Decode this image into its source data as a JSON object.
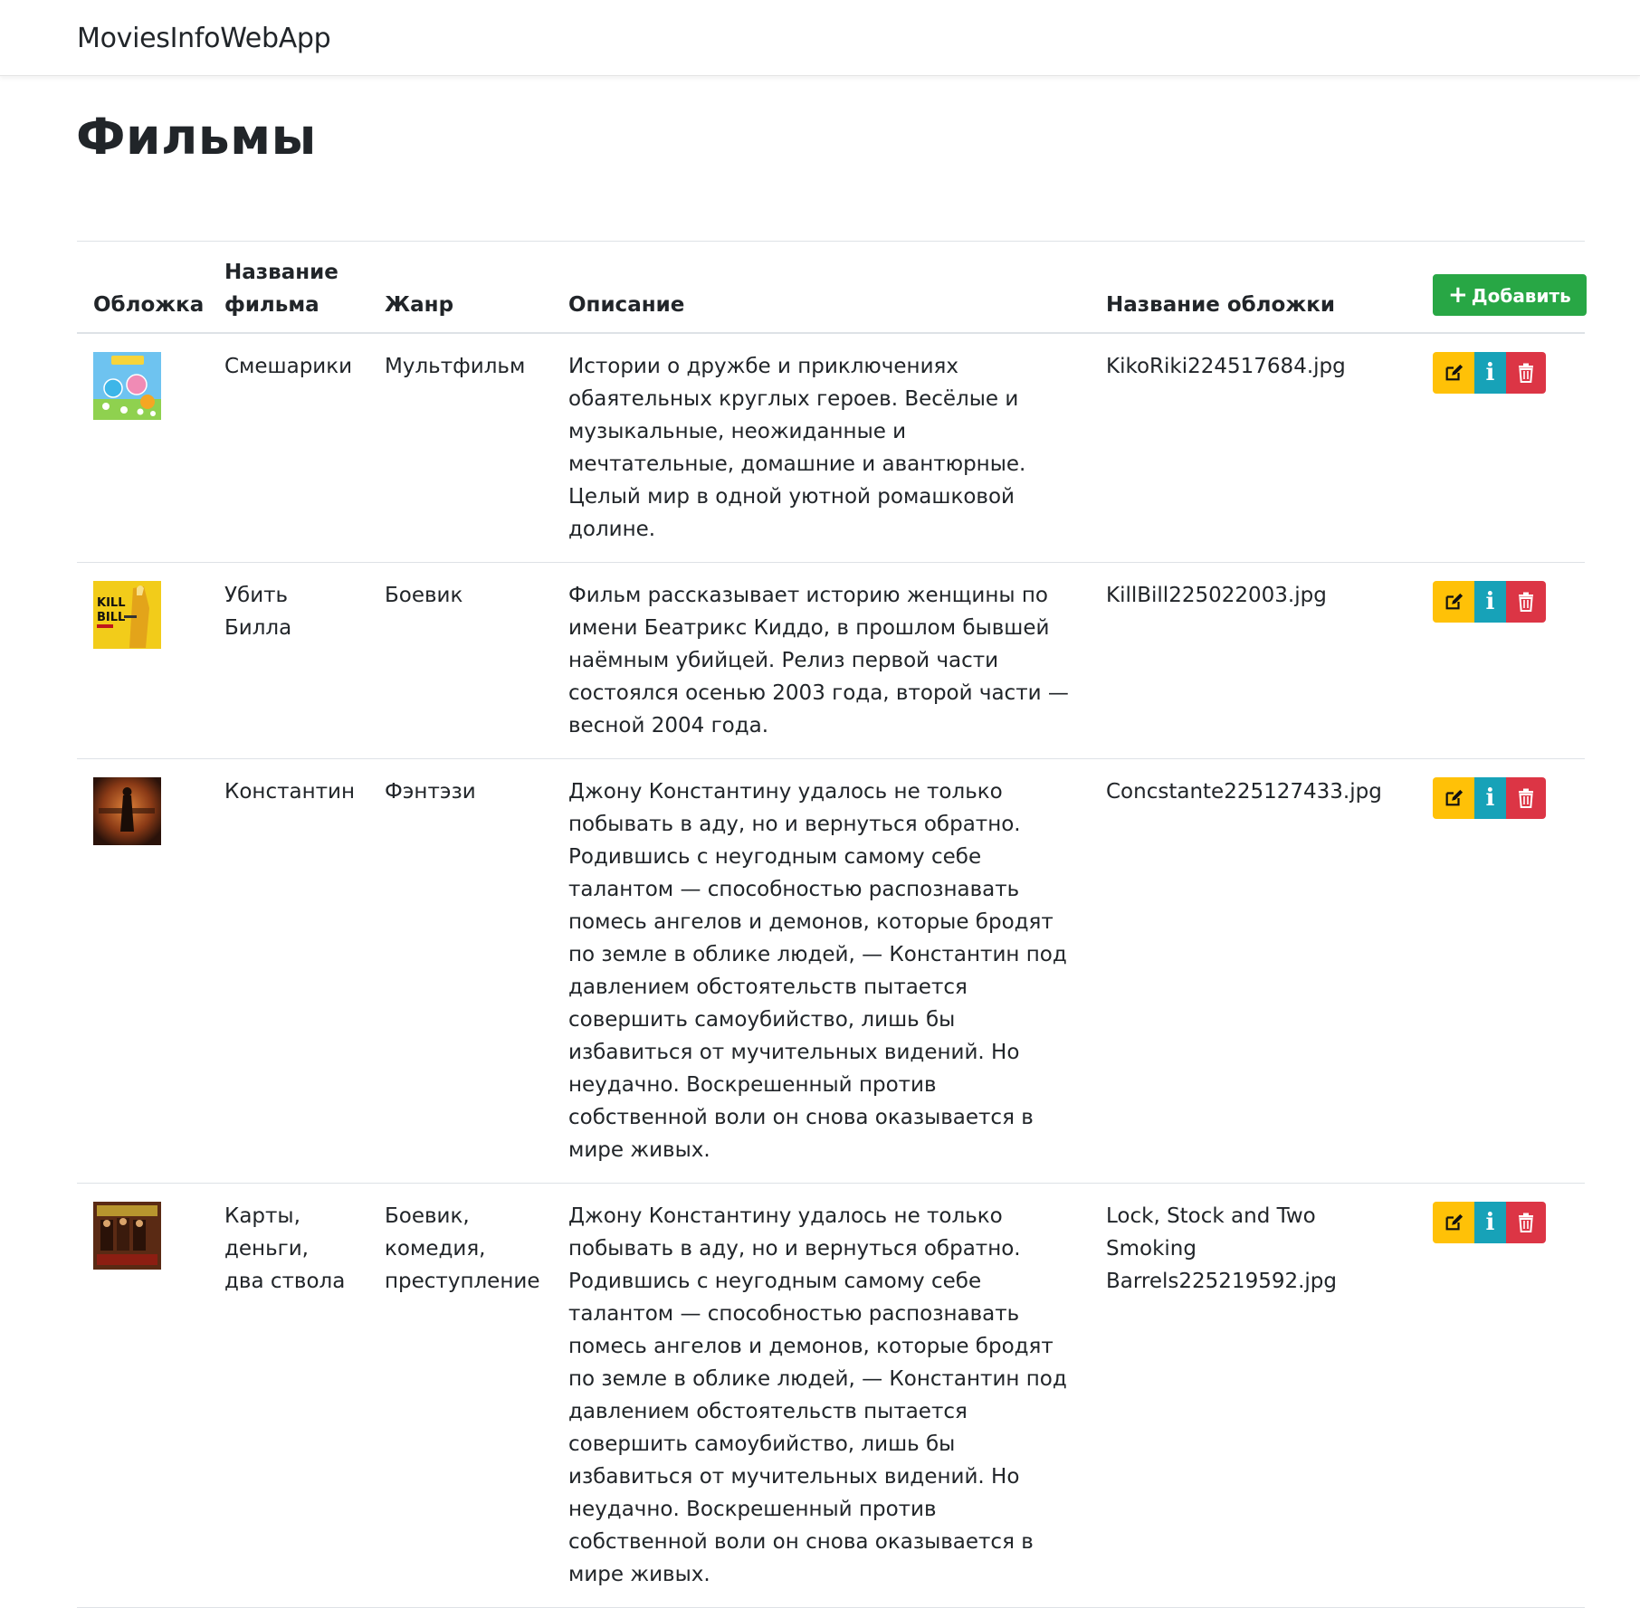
{
  "navbar": {
    "brand": "MoviesInfoWebApp"
  },
  "page": {
    "title": "Фильмы"
  },
  "table": {
    "headers": {
      "cover": "Обложка",
      "name": "Название фильма",
      "genre": "Жанр",
      "description": "Описание",
      "cover_name": "Название обложки"
    },
    "add_button": {
      "label": "Добавить",
      "icon": "plus-icon",
      "color": "#28a745"
    },
    "action_colors": {
      "edit": "#ffc107",
      "info": "#17a2b8",
      "delete": "#dc3545"
    },
    "rows": [
      {
        "name": "Смешарики",
        "genre": "Мультфильм",
        "description": "Истории о дружбе и приключениях обаятельных круглых героев. Весёлые и музыкальные, неожиданные и мечтательные, домашние и авантюрные. Целый мир в одной уютной ромашковой долине.",
        "cover_name": "KikoRiki224517684.jpg"
      },
      {
        "name": "Убить Билла",
        "genre": "Боевик",
        "description": "Фильм рассказывает историю женщины по имени Беатрикс Киддо, в прошлом бывшей наёмным убийцей. Релиз первой части состоялся осенью 2003 года, второй части — весной 2004 года.",
        "cover_name": "KillBill225022003.jpg"
      },
      {
        "name": "Константин",
        "genre": "Фэнтэзи",
        "description": "Джону Константину удалось не только побывать в аду, но и вернуться обратно. Родившись с неугодным самому себе талантом — способностью распознавать помесь ангелов и демонов, которые бродят по земле в облике людей, — Константин под давлением обстоятельств пытается совершить самоубийство, лишь бы избавиться от мучительных видений. Но неудачно. Воскрешенный против собственной воли он снова оказывается в мире живых.",
        "cover_name": "Concstante225127433.jpg"
      },
      {
        "name": "Карты, деньги, два ствола",
        "genre": "Боевик, комедия, преступление",
        "description": "Джону Константину удалось не только побывать в аду, но и вернуться обратно. Родившись с неугодным самому себе талантом — способностью распознавать помесь ангелов и демонов, которые бродят по земле в облике людей, — Константин под давлением обстоятельств пытается совершить самоубийство, лишь бы избавиться от мучительных видений. Но неудачно. Воскрешенный против собственной воли он снова оказывается в мире живых.",
        "cover_name": "Lock, Stock and Two Smoking Barrels225219592.jpg"
      }
    ]
  }
}
